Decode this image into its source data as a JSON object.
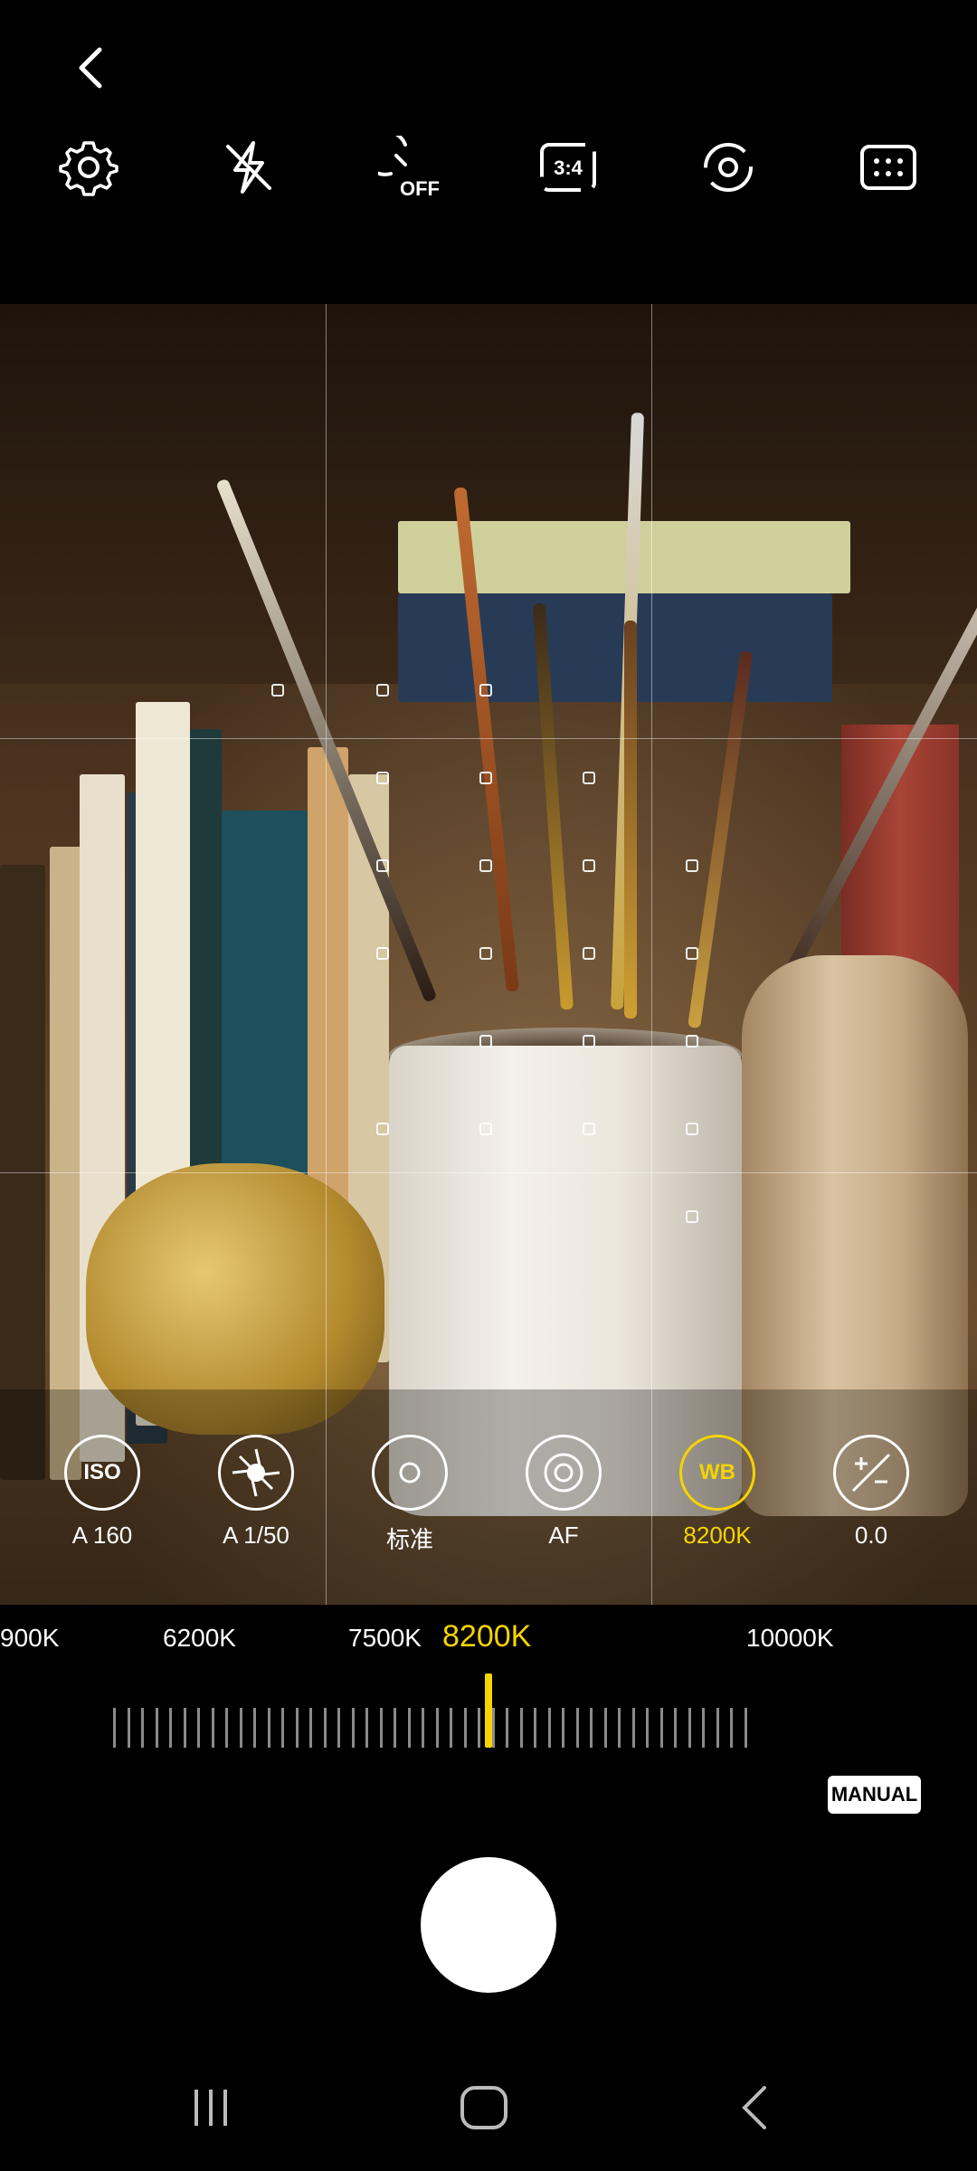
{
  "top_bar": {
    "back_icon": "chevron-left-icon",
    "toolbar_icons": [
      "gear-icon",
      "flash-off-icon",
      "timer-off-icon",
      "aspect-ratio-icon",
      "switch-camera-icon",
      "grid-icon"
    ],
    "timer_label": "OFF",
    "ratio_label": "3:4"
  },
  "pro_controls": [
    {
      "id": "iso",
      "icon_text": "ISO",
      "value": "A 160"
    },
    {
      "id": "shutter",
      "icon_text": "",
      "value": "A 1/50"
    },
    {
      "id": "metering",
      "icon_text": "",
      "value": "标准"
    },
    {
      "id": "focus",
      "icon_text": "",
      "value": "AF"
    },
    {
      "id": "white-balance",
      "icon_text": "WB",
      "value": "8200K",
      "active": true
    },
    {
      "id": "exposure",
      "icon_text": "",
      "value": "0.0"
    }
  ],
  "wb_scale": {
    "labels": [
      "900K",
      "6200K",
      "7500K",
      "8200K",
      "10000K"
    ],
    "selected": "8200K",
    "accent_color": "#f5d400"
  },
  "mode_badge": "MANUAL",
  "nav_icons": [
    "recent-apps-icon",
    "home-icon",
    "back-icon"
  ]
}
